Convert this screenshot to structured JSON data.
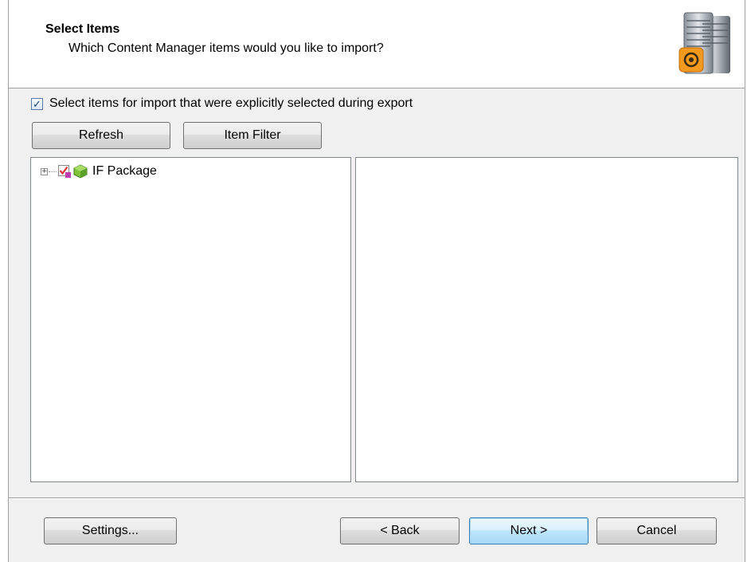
{
  "header": {
    "title": "Select Items",
    "subtitle": "Which Content Manager items would you like to import?",
    "icon": "database-server-icon"
  },
  "options": {
    "explicit_selection_label": "Select items for import that were explicitly selected during export",
    "explicit_selection_checked": true
  },
  "toolbar": {
    "refresh_label": "Refresh",
    "item_filter_label": "Item Filter"
  },
  "tree": {
    "items": [
      {
        "label": "IF Package",
        "expanded": false,
        "checked": true,
        "icon": "package-icon"
      }
    ]
  },
  "footer": {
    "settings_label": "Settings...",
    "back_label": "< Back",
    "next_label": "Next >",
    "cancel_label": "Cancel"
  }
}
